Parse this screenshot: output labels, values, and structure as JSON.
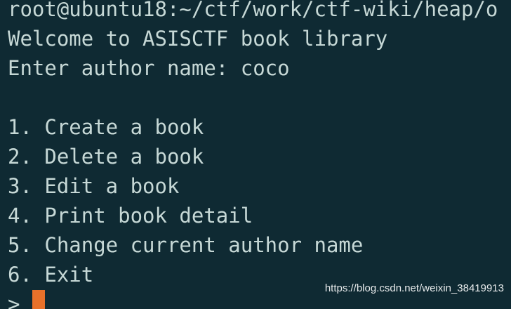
{
  "terminal": {
    "top_line": "root@ubuntu18:~/ctf/work/ctf-wiki/heap/o",
    "welcome": "Welcome to ASISCTF book library",
    "author_prompt": "Enter author name: coco",
    "blank": "",
    "menu": [
      "1. Create a book",
      "2. Delete a book",
      "3. Edit a book",
      "4. Print book detail",
      "5. Change current author name",
      "6. Exit"
    ],
    "prompt_symbol": ">"
  },
  "watermark": "https://blog.csdn.net/weixin_38419913",
  "colors": {
    "background": "#0f2a33",
    "text": "#c6d8d6",
    "cursor": "#e8712a"
  }
}
